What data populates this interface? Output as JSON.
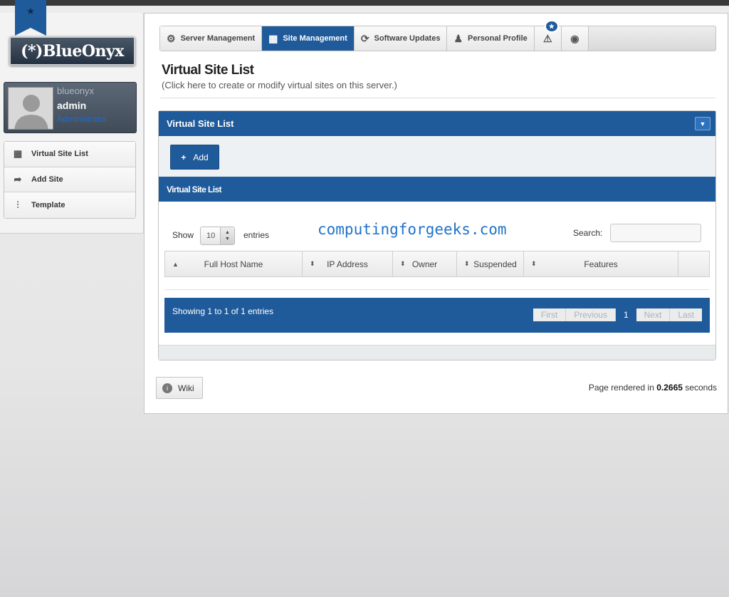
{
  "brand": {
    "logo_text": "(*)BlueOnyx"
  },
  "user": {
    "display_name": "blueonyx",
    "login": "admin",
    "role": "Administrator"
  },
  "sidebar": {
    "items": [
      {
        "label": "Virtual Site List",
        "icon": "layout-icon"
      },
      {
        "label": "Add Site",
        "icon": "share-arrow-icon"
      },
      {
        "label": "Template",
        "icon": "sliders-icon"
      }
    ]
  },
  "tabs": [
    {
      "label": "Server Management",
      "icon": "gear-icon",
      "active": false
    },
    {
      "label": "Site Management",
      "icon": "layout-icon",
      "active": true
    },
    {
      "label": "Software Updates",
      "icon": "refresh-icon",
      "active": false
    },
    {
      "label": "Personal Profile",
      "icon": "person-icon",
      "active": false
    }
  ],
  "page": {
    "title": "Virtual Site List",
    "subtitle": "(Click here to create or modify virtual sites on this server.)"
  },
  "panel": {
    "title": "Virtual Site List",
    "add_label": "Add",
    "list_title": "Virtual Site List"
  },
  "table": {
    "show_label": "Show",
    "length_value": "10",
    "entries_label": "entries",
    "search_label": "Search:",
    "search_value": "",
    "watermark": "computingforgeeks.com",
    "columns": [
      "Full Host Name",
      "IP Address",
      "Owner",
      "Suspended",
      "Features"
    ],
    "info": "Showing 1 to 1 of 1 entries",
    "pager": {
      "first": "First",
      "previous": "Previous",
      "current": "1",
      "next": "Next",
      "last": "Last"
    }
  },
  "footer": {
    "wiki_label": "Wiki",
    "rendered_prefix": "Page rendered in",
    "rendered_time": "0.2665",
    "rendered_suffix": "seconds"
  },
  "colors": {
    "primary": "#1f5a9a",
    "role_link": "#1e6bd0",
    "watermark": "#1f73c9"
  }
}
